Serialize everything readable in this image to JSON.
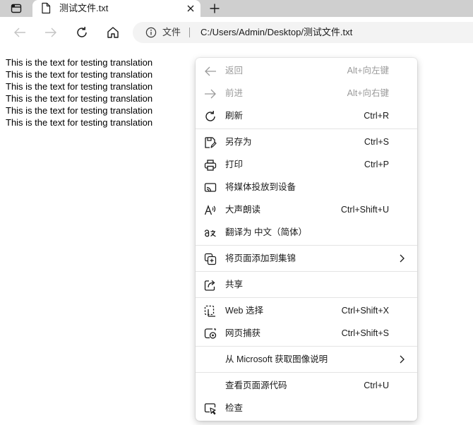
{
  "tab": {
    "title": "测试文件.txt"
  },
  "address": {
    "site_label": "文件",
    "url": "C:/Users/Admin/Desktop/测试文件.txt"
  },
  "content": {
    "lines": [
      "This is the text for testing translation",
      "This is the text for testing translation",
      "This is the text for testing translation",
      "This is the text for testing translation",
      "This is the text for testing translation",
      "This is the text for testing translation"
    ]
  },
  "menu": {
    "items": [
      {
        "label": "返回",
        "shortcut": "Alt+向左键",
        "icon": "arrow-left-icon",
        "disabled": true
      },
      {
        "label": "前进",
        "shortcut": "Alt+向右键",
        "icon": "arrow-right-icon",
        "disabled": true
      },
      {
        "label": "刷新",
        "shortcut": "Ctrl+R",
        "icon": "refresh-icon"
      },
      {
        "label": "另存为",
        "shortcut": "Ctrl+S",
        "icon": "save-as-icon"
      },
      {
        "label": "打印",
        "shortcut": "Ctrl+P",
        "icon": "print-icon"
      },
      {
        "label": "将媒体投放到设备",
        "shortcut": "",
        "icon": "cast-icon"
      },
      {
        "label": "大声朗读",
        "shortcut": "Ctrl+Shift+U",
        "icon": "read-aloud-icon"
      },
      {
        "label": "翻译为 中文（简体）",
        "shortcut": "",
        "icon": "translate-icon"
      },
      {
        "label": "将页面添加到集锦",
        "shortcut": "",
        "icon": "collections-icon"
      },
      {
        "label": "共享",
        "shortcut": "",
        "icon": "share-icon"
      },
      {
        "label": "Web 选择",
        "shortcut": "Ctrl+Shift+X",
        "icon": "web-select-icon"
      },
      {
        "label": "网页捕获",
        "shortcut": "Ctrl+Shift+S",
        "icon": "web-capture-icon"
      },
      {
        "label": "从 Microsoft 获取图像说明",
        "shortcut": "",
        "icon": ""
      },
      {
        "label": "查看页面源代码",
        "shortcut": "Ctrl+U",
        "icon": ""
      },
      {
        "label": "检查",
        "shortcut": "",
        "icon": "inspect-icon"
      }
    ]
  },
  "colors": {
    "tabstrip": "#cfcfcf",
    "address_bg": "#f3f3f3",
    "disabled_text": "#9a9a9a",
    "separator": "#e4e4e4"
  }
}
